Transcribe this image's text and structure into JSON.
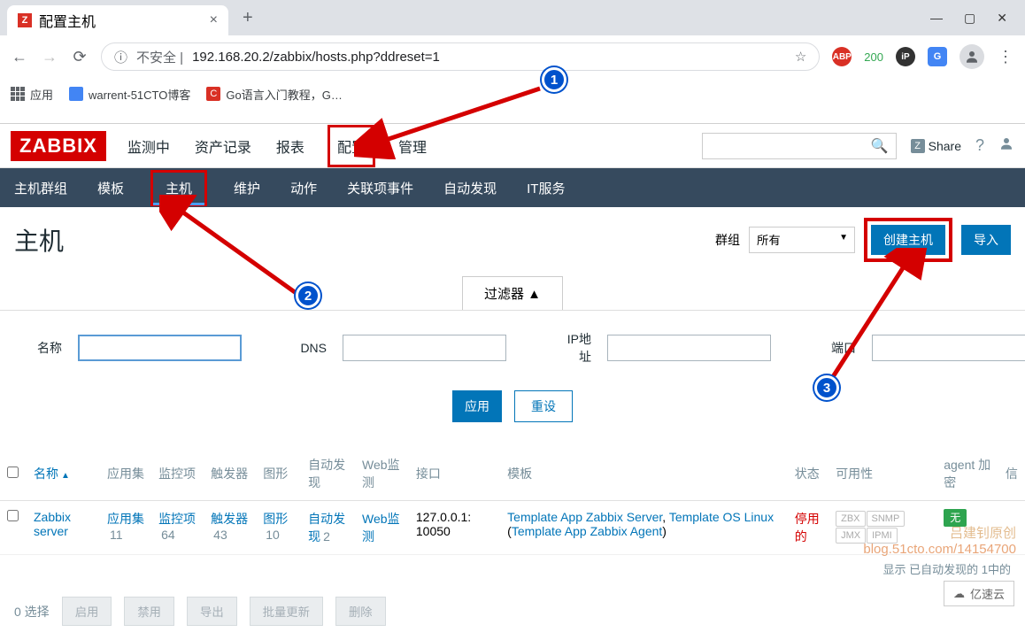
{
  "browser": {
    "tab_title": "配置主机",
    "url_prefix": "不安全 | ",
    "url": "192.168.20.2/zabbix/hosts.php?ddreset=1",
    "ext_abp": "ABP",
    "ext_count": "200",
    "bookmarks": {
      "apps": "应用",
      "bm1": "warrent-51CTO博客",
      "bm2": "Go语言入门教程，G…"
    }
  },
  "zabbix": {
    "logo": "ZABBIX",
    "nav": [
      "监测中",
      "资产记录",
      "报表",
      "配置",
      "管理"
    ],
    "subnav": [
      "主机群组",
      "模板",
      "主机",
      "维护",
      "动作",
      "关联项事件",
      "自动发现",
      "IT服务"
    ],
    "share": "Share",
    "page_title": "主机",
    "group_label": "群组",
    "group_value": "所有",
    "create_host": "创建主机",
    "import": "导入",
    "filter": {
      "tab": "过滤器 ▲",
      "name": "名称",
      "dns": "DNS",
      "ip": "IP地址",
      "port": "端口",
      "apply": "应用",
      "reset": "重设"
    },
    "columns": {
      "name": "名称",
      "apps": "应用集",
      "items": "监控项",
      "triggers": "触发器",
      "graphs": "图形",
      "discovery": "自动发现",
      "web": "Web监测",
      "interface": "接口",
      "templates": "模板",
      "status": "状态",
      "availability": "可用性",
      "agent": "agent 加密",
      "info": "信"
    },
    "row": {
      "name": "Zabbix server",
      "apps_label": "应用集",
      "apps_count": "11",
      "items_label": "监控项",
      "items_count": "64",
      "triggers_label": "触发器",
      "triggers_count": "43",
      "graphs_label": "图形",
      "graphs_count": "10",
      "discovery_label": "自动发现",
      "discovery_count": "2",
      "web_label": "Web监测",
      "interface": "127.0.0.1: 10050",
      "template1": "Template App Zabbix Server",
      "template2": "Template OS Linux",
      "template3": "Template App Zabbix Agent",
      "status": "停用的",
      "avail": [
        "ZBX",
        "SNMP",
        "JMX",
        "IPMI"
      ],
      "enc": "无"
    },
    "footer": {
      "selected": "0 选择",
      "enable": "启用",
      "disable": "禁用",
      "export": "导出",
      "massupdate": "批量更新",
      "delete": "删除",
      "displaying": "显示 已自动发现的 1中的"
    }
  },
  "watermark": {
    "line1": "吕建钊原创",
    "line2": "blog.51cto.com/14154700"
  },
  "yisu": "亿速云"
}
